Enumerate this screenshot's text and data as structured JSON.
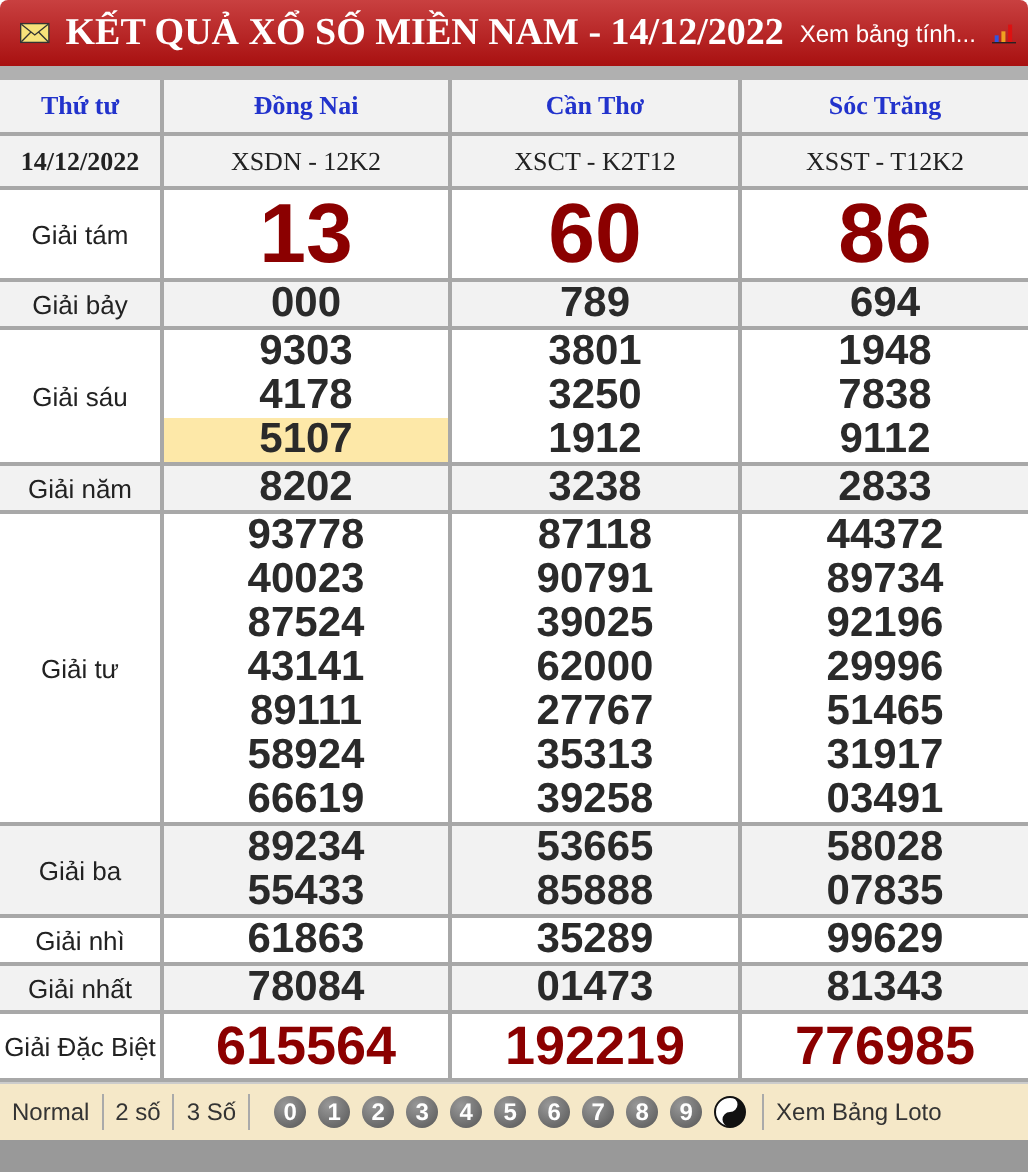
{
  "header": {
    "title": "KẾT QUẢ XỔ SỐ MIỀN NAM - 14/12/2022",
    "link": "Xem bảng tính..."
  },
  "table": {
    "columns": [
      "Thứ tư",
      "Đồng Nai",
      "Cần Thơ",
      "Sóc Trăng"
    ],
    "date_row": [
      "14/12/2022",
      "XSDN - 12K2",
      "XSCT - K2T12",
      "XSST - T12K2"
    ],
    "rows": [
      {
        "kind": "big",
        "cells": [
          {
            "label": "Giải tám"
          },
          {
            "numbers": [
              {
                "value": "13",
                "highlighted": false
              }
            ]
          },
          {
            "numbers": [
              {
                "value": "60",
                "highlighted": false
              }
            ]
          },
          {
            "numbers": [
              {
                "value": "86",
                "highlighted": false
              }
            ]
          }
        ]
      },
      {
        "kind": "normal",
        "cells": [
          {
            "label": "Giải bảy"
          },
          {
            "numbers": [
              {
                "value": "000",
                "highlighted": false
              }
            ]
          },
          {
            "numbers": [
              {
                "value": "789",
                "highlighted": false
              }
            ]
          },
          {
            "numbers": [
              {
                "value": "694",
                "highlighted": false
              }
            ]
          }
        ]
      },
      {
        "kind": "normal",
        "cells": [
          {
            "label": "Giải sáu"
          },
          {
            "numbers": [
              {
                "value": "9303",
                "highlighted": false
              },
              {
                "value": "4178",
                "highlighted": false
              },
              {
                "value": "5107",
                "highlighted": true
              }
            ]
          },
          {
            "numbers": [
              {
                "value": "3801",
                "highlighted": false
              },
              {
                "value": "3250",
                "highlighted": false
              },
              {
                "value": "1912",
                "highlighted": false
              }
            ]
          },
          {
            "numbers": [
              {
                "value": "1948",
                "highlighted": false
              },
              {
                "value": "7838",
                "highlighted": false
              },
              {
                "value": "9112",
                "highlighted": false
              }
            ]
          }
        ]
      },
      {
        "kind": "normal",
        "cells": [
          {
            "label": "Giải năm"
          },
          {
            "numbers": [
              {
                "value": "8202",
                "highlighted": false
              }
            ]
          },
          {
            "numbers": [
              {
                "value": "3238",
                "highlighted": false
              }
            ]
          },
          {
            "numbers": [
              {
                "value": "2833",
                "highlighted": false
              }
            ]
          }
        ]
      },
      {
        "kind": "normal",
        "cells": [
          {
            "label": "Giải tư"
          },
          {
            "numbers": [
              {
                "value": "93778",
                "highlighted": false
              },
              {
                "value": "40023",
                "highlighted": false
              },
              {
                "value": "87524",
                "highlighted": false
              },
              {
                "value": "43141",
                "highlighted": false
              },
              {
                "value": "89111",
                "highlighted": false
              },
              {
                "value": "58924",
                "highlighted": false
              },
              {
                "value": "66619",
                "highlighted": false
              }
            ]
          },
          {
            "numbers": [
              {
                "value": "87118",
                "highlighted": false
              },
              {
                "value": "90791",
                "highlighted": false
              },
              {
                "value": "39025",
                "highlighted": false
              },
              {
                "value": "62000",
                "highlighted": false
              },
              {
                "value": "27767",
                "highlighted": false
              },
              {
                "value": "35313",
                "highlighted": false
              },
              {
                "value": "39258",
                "highlighted": false
              }
            ]
          },
          {
            "numbers": [
              {
                "value": "44372",
                "highlighted": false
              },
              {
                "value": "89734",
                "highlighted": false
              },
              {
                "value": "92196",
                "highlighted": false
              },
              {
                "value": "29996",
                "highlighted": false
              },
              {
                "value": "51465",
                "highlighted": false
              },
              {
                "value": "31917",
                "highlighted": false
              },
              {
                "value": "03491",
                "highlighted": false
              }
            ]
          }
        ]
      },
      {
        "kind": "normal",
        "cells": [
          {
            "label": "Giải ba"
          },
          {
            "numbers": [
              {
                "value": "89234",
                "highlighted": false
              },
              {
                "value": "55433",
                "highlighted": false
              }
            ]
          },
          {
            "numbers": [
              {
                "value": "53665",
                "highlighted": false
              },
              {
                "value": "85888",
                "highlighted": false
              }
            ]
          },
          {
            "numbers": [
              {
                "value": "58028",
                "highlighted": false
              },
              {
                "value": "07835",
                "highlighted": false
              }
            ]
          }
        ]
      },
      {
        "kind": "normal",
        "cells": [
          {
            "label": "Giải nhì"
          },
          {
            "numbers": [
              {
                "value": "61863",
                "highlighted": false
              }
            ]
          },
          {
            "numbers": [
              {
                "value": "35289",
                "highlighted": false
              }
            ]
          },
          {
            "numbers": [
              {
                "value": "99629",
                "highlighted": false
              }
            ]
          }
        ]
      },
      {
        "kind": "normal",
        "cells": [
          {
            "label": "Giải nhất"
          },
          {
            "numbers": [
              {
                "value": "78084",
                "highlighted": false
              }
            ]
          },
          {
            "numbers": [
              {
                "value": "01473",
                "highlighted": false
              }
            ]
          },
          {
            "numbers": [
              {
                "value": "81343",
                "highlighted": false
              }
            ]
          }
        ]
      },
      {
        "kind": "special",
        "cells": [
          {
            "label": "Giải Đặc Biệt"
          },
          {
            "numbers": [
              {
                "value": "615564",
                "highlighted": false
              }
            ]
          },
          {
            "numbers": [
              {
                "value": "192219",
                "highlighted": false
              }
            ]
          },
          {
            "numbers": [
              {
                "value": "776985",
                "highlighted": false
              }
            ]
          }
        ]
      }
    ]
  },
  "footer": {
    "modes": [
      "Normal",
      "2 số",
      "3 Số"
    ],
    "digits": [
      "0",
      "1",
      "2",
      "3",
      "4",
      "5",
      "6",
      "7",
      "8",
      "9"
    ],
    "link": "Xem Bảng Loto"
  }
}
